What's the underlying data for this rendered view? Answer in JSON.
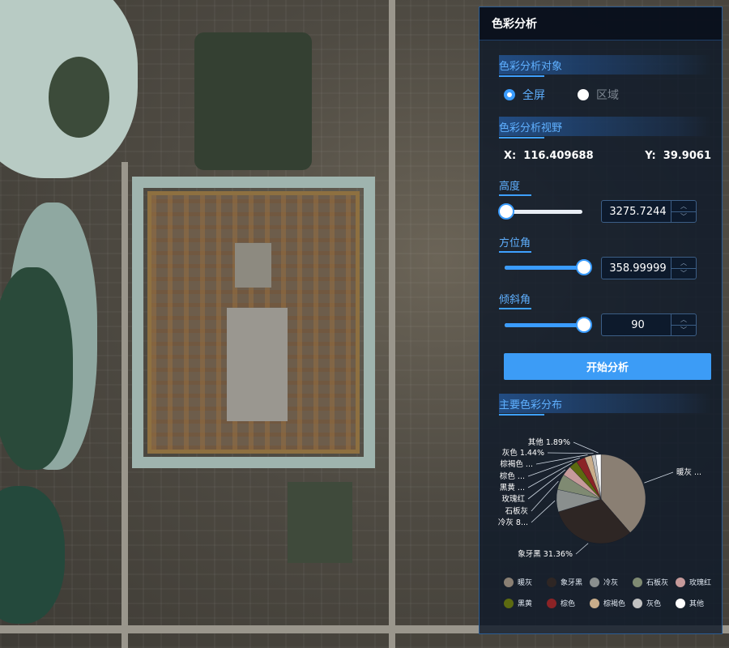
{
  "panel": {
    "title": "色彩分析",
    "target_section": "色彩分析对象",
    "target_options": [
      {
        "label": "全屏",
        "selected": true
      },
      {
        "label": "区域",
        "selected": false
      }
    ],
    "view_section": "色彩分析视野",
    "coords": {
      "x_label": "X:",
      "x_value": "116.409688",
      "y_label": "Y:",
      "y_value": "39.9061"
    },
    "height": {
      "label": "高度",
      "value": "3275.7244",
      "level": 0.0
    },
    "azimuth": {
      "label": "方位角",
      "value": "358.99999",
      "level": 1.0
    },
    "tilt": {
      "label": "倾斜角",
      "value": "90",
      "level": 1.0
    },
    "start_button": "开始分析",
    "distribution_section": "主要色彩分布"
  },
  "chart_data": {
    "type": "pie",
    "title": "",
    "slices": [
      {
        "name": "暖灰",
        "label": "暖灰 ...",
        "value": 38.2,
        "color": "#8a7f73"
      },
      {
        "name": "象牙黑",
        "label": "象牙黑 31.36%",
        "value": 31.36,
        "color": "#2e2624"
      },
      {
        "name": "冷灰",
        "label": "冷灰 8...",
        "value": 8.0,
        "color": "#8a8f8e"
      },
      {
        "name": "石板灰",
        "label": "石板灰",
        "value": 5.6,
        "color": "#7f8a72"
      },
      {
        "name": "玫瑰红",
        "label": "玫瑰红",
        "value": 3.6,
        "color": "#c69a9a"
      },
      {
        "name": "黑黄",
        "label": "黑黄 ...",
        "value": 3.0,
        "color": "#5c6a10"
      },
      {
        "name": "棕色",
        "label": "棕色 ...",
        "value": 3.2,
        "color": "#8b2326"
      },
      {
        "name": "棕褐色",
        "label": "棕褐色 ...",
        "value": 2.6,
        "color": "#c9ad8a"
      },
      {
        "name": "灰色",
        "label": "灰色 1.44%",
        "value": 1.44,
        "color": "#c2c2c2"
      },
      {
        "name": "其他",
        "label": "其他 1.89%",
        "value": 1.89,
        "color": "#ffffff"
      }
    ],
    "legend_position": "bottom"
  }
}
